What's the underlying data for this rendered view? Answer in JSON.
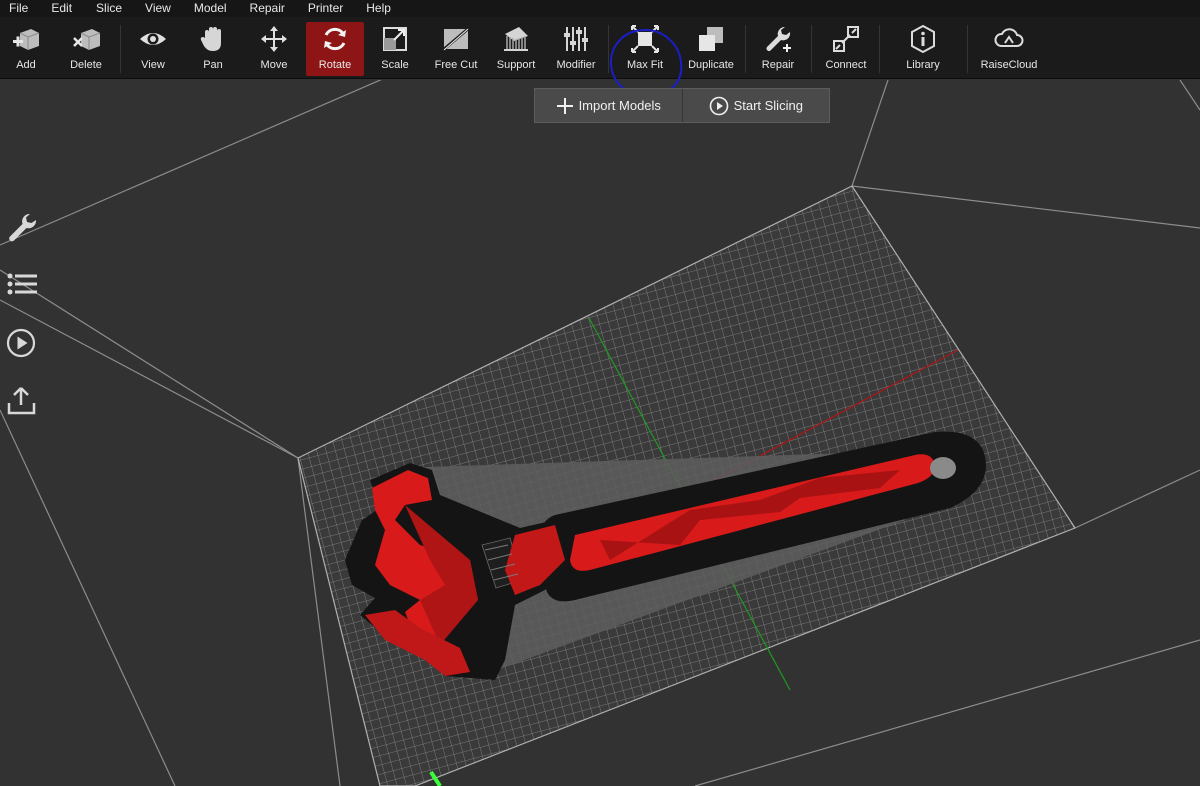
{
  "menu": [
    "File",
    "Edit",
    "Slice",
    "View",
    "Model",
    "Repair",
    "Printer",
    "Help"
  ],
  "toolbar": {
    "add": "Add",
    "delete": "Delete",
    "view": "View",
    "pan": "Pan",
    "move": "Move",
    "rotate": "Rotate",
    "scale": "Scale",
    "free_cut": "Free Cut",
    "support": "Support",
    "modifier": "Modifier",
    "max_fit": "Max Fit",
    "duplicate": "Duplicate",
    "repair": "Repair",
    "connect": "Connect",
    "library": "Library",
    "raisecloud": "RaiseCloud"
  },
  "actions": {
    "import_models": "Import Models",
    "start_slicing": "Start Slicing"
  },
  "sidebar_icons": [
    "wrench-icon",
    "list-icon",
    "play-icon",
    "upload-icon"
  ],
  "colors": {
    "active_tool": "#8d1515",
    "model_red": "#d81a1a",
    "highlight_circle": "#1a1ec8",
    "axis_x": "#b01515",
    "axis_y": "#1f9a1f"
  }
}
